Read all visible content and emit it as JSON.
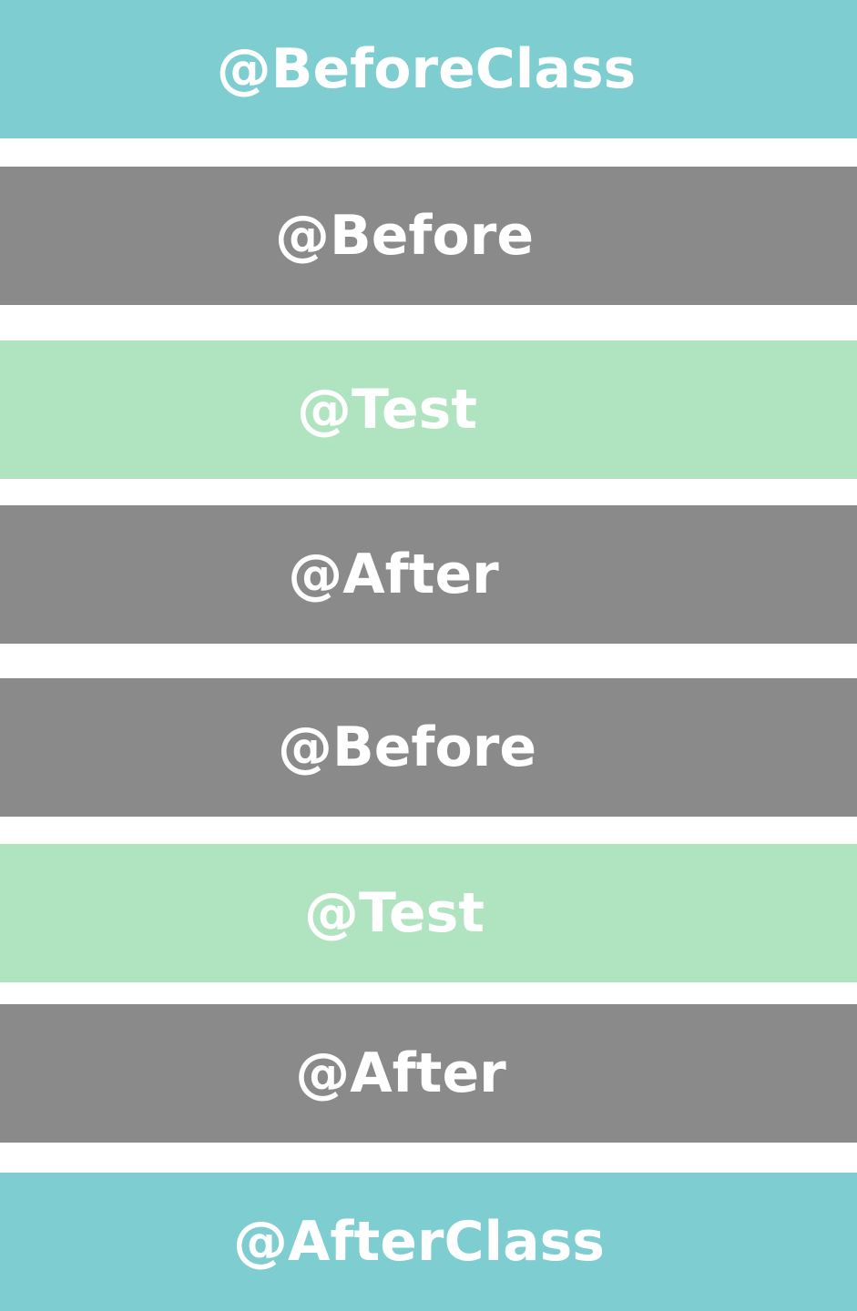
{
  "colors": {
    "class_level": "#7ecdd0",
    "method_level": "#8a8a8a",
    "test": "#b0e3bf",
    "text": "#ffffff"
  },
  "steps": [
    {
      "label": "@BeforeClass",
      "kind": "class_level"
    },
    {
      "label": "@Before",
      "kind": "method_level"
    },
    {
      "label": "@Test",
      "kind": "test"
    },
    {
      "label": "@After",
      "kind": "method_level"
    },
    {
      "label": "@Before",
      "kind": "method_level"
    },
    {
      "label": "@Test",
      "kind": "test"
    },
    {
      "label": "@After",
      "kind": "method_level"
    },
    {
      "label": "@AfterClass",
      "kind": "class_level"
    }
  ]
}
